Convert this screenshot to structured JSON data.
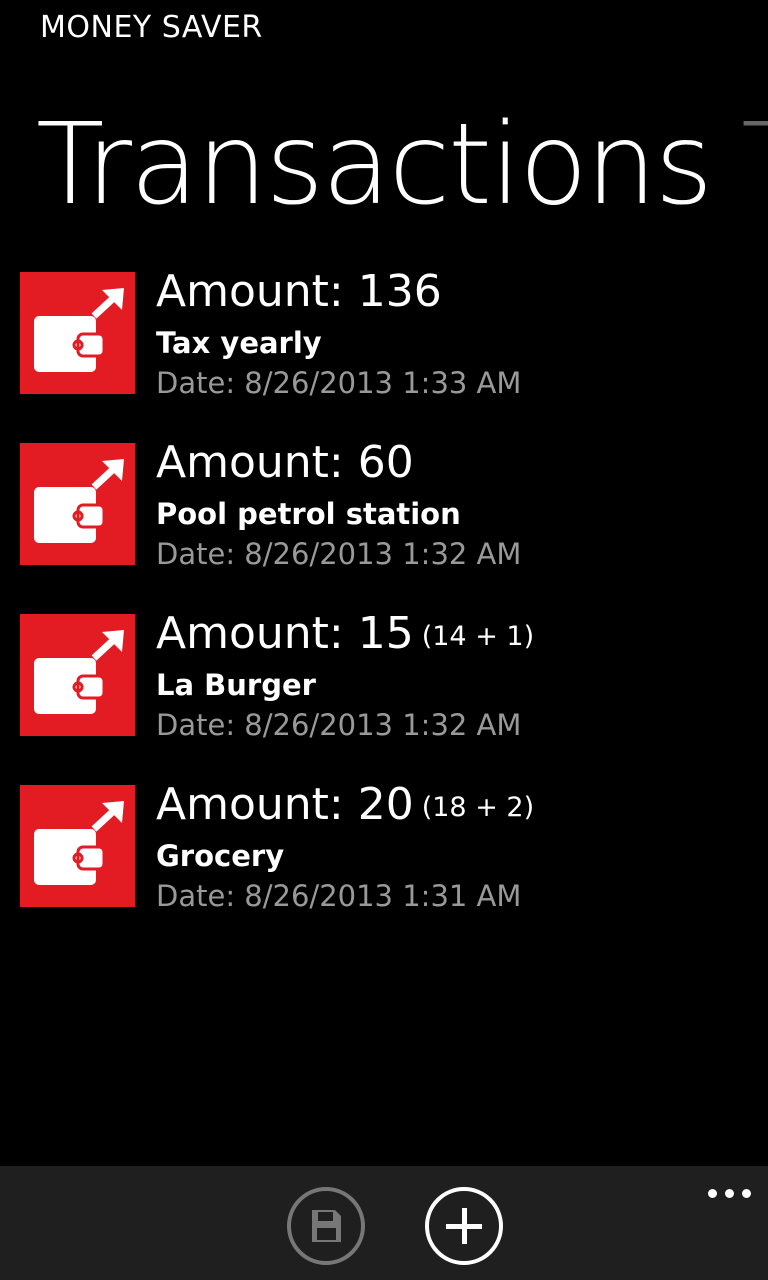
{
  "app": {
    "title": "MONEY SAVER"
  },
  "pivot": {
    "active": "Transactions",
    "next": "Tr"
  },
  "transactions": [
    {
      "amount": "Amount: 136",
      "split": "",
      "name": "Tax yearly",
      "date": "Date: 8/26/2013 1:33 AM",
      "icon": "wallet-out-icon"
    },
    {
      "amount": "Amount: 60",
      "split": "",
      "name": "Pool petrol station",
      "date": "Date: 8/26/2013 1:32 AM",
      "icon": "wallet-out-icon"
    },
    {
      "amount": "Amount: 15",
      "split": "(14 + 1)",
      "name": "La Burger",
      "date": "Date: 8/26/2013 1:32 AM",
      "icon": "wallet-out-icon"
    },
    {
      "amount": "Amount: 20",
      "split": "(18 + 2)",
      "name": "Grocery",
      "date": "Date: 8/26/2013 1:31 AM",
      "icon": "wallet-out-icon"
    }
  ],
  "appbar": {
    "buttons": [
      {
        "icon": "save-icon",
        "enabled": false
      },
      {
        "icon": "add-icon",
        "enabled": true
      }
    ],
    "more_icon": "ellipsis-icon"
  },
  "colors": {
    "background": "#000000",
    "tile": "#e31b23",
    "appbar": "#1f1f1f",
    "secondary_text": "#999999",
    "disabled": "#777777"
  }
}
